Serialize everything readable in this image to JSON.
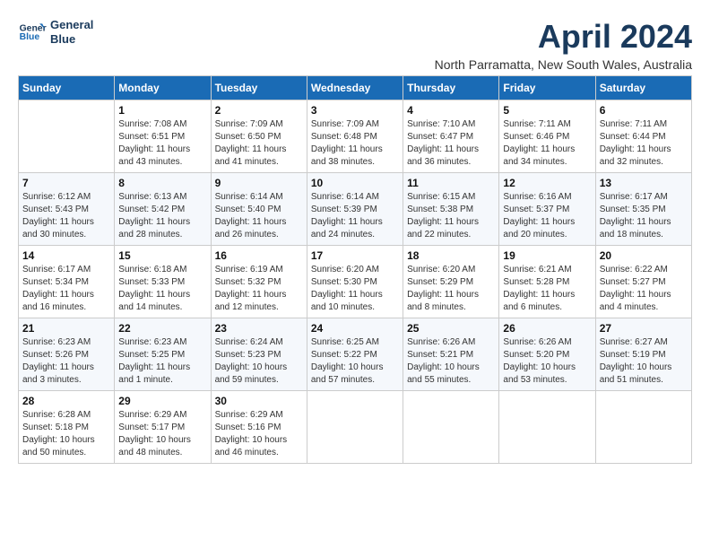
{
  "logo": {
    "line1": "General",
    "line2": "Blue"
  },
  "title": "April 2024",
  "subtitle": "North Parramatta, New South Wales, Australia",
  "headers": [
    "Sunday",
    "Monday",
    "Tuesday",
    "Wednesday",
    "Thursday",
    "Friday",
    "Saturday"
  ],
  "weeks": [
    [
      {
        "day": "",
        "info": ""
      },
      {
        "day": "1",
        "info": "Sunrise: 7:08 AM\nSunset: 6:51 PM\nDaylight: 11 hours\nand 43 minutes."
      },
      {
        "day": "2",
        "info": "Sunrise: 7:09 AM\nSunset: 6:50 PM\nDaylight: 11 hours\nand 41 minutes."
      },
      {
        "day": "3",
        "info": "Sunrise: 7:09 AM\nSunset: 6:48 PM\nDaylight: 11 hours\nand 38 minutes."
      },
      {
        "day": "4",
        "info": "Sunrise: 7:10 AM\nSunset: 6:47 PM\nDaylight: 11 hours\nand 36 minutes."
      },
      {
        "day": "5",
        "info": "Sunrise: 7:11 AM\nSunset: 6:46 PM\nDaylight: 11 hours\nand 34 minutes."
      },
      {
        "day": "6",
        "info": "Sunrise: 7:11 AM\nSunset: 6:44 PM\nDaylight: 11 hours\nand 32 minutes."
      }
    ],
    [
      {
        "day": "7",
        "info": "Sunrise: 6:12 AM\nSunset: 5:43 PM\nDaylight: 11 hours\nand 30 minutes."
      },
      {
        "day": "8",
        "info": "Sunrise: 6:13 AM\nSunset: 5:42 PM\nDaylight: 11 hours\nand 28 minutes."
      },
      {
        "day": "9",
        "info": "Sunrise: 6:14 AM\nSunset: 5:40 PM\nDaylight: 11 hours\nand 26 minutes."
      },
      {
        "day": "10",
        "info": "Sunrise: 6:14 AM\nSunset: 5:39 PM\nDaylight: 11 hours\nand 24 minutes."
      },
      {
        "day": "11",
        "info": "Sunrise: 6:15 AM\nSunset: 5:38 PM\nDaylight: 11 hours\nand 22 minutes."
      },
      {
        "day": "12",
        "info": "Sunrise: 6:16 AM\nSunset: 5:37 PM\nDaylight: 11 hours\nand 20 minutes."
      },
      {
        "day": "13",
        "info": "Sunrise: 6:17 AM\nSunset: 5:35 PM\nDaylight: 11 hours\nand 18 minutes."
      }
    ],
    [
      {
        "day": "14",
        "info": "Sunrise: 6:17 AM\nSunset: 5:34 PM\nDaylight: 11 hours\nand 16 minutes."
      },
      {
        "day": "15",
        "info": "Sunrise: 6:18 AM\nSunset: 5:33 PM\nDaylight: 11 hours\nand 14 minutes."
      },
      {
        "day": "16",
        "info": "Sunrise: 6:19 AM\nSunset: 5:32 PM\nDaylight: 11 hours\nand 12 minutes."
      },
      {
        "day": "17",
        "info": "Sunrise: 6:20 AM\nSunset: 5:30 PM\nDaylight: 11 hours\nand 10 minutes."
      },
      {
        "day": "18",
        "info": "Sunrise: 6:20 AM\nSunset: 5:29 PM\nDaylight: 11 hours\nand 8 minutes."
      },
      {
        "day": "19",
        "info": "Sunrise: 6:21 AM\nSunset: 5:28 PM\nDaylight: 11 hours\nand 6 minutes."
      },
      {
        "day": "20",
        "info": "Sunrise: 6:22 AM\nSunset: 5:27 PM\nDaylight: 11 hours\nand 4 minutes."
      }
    ],
    [
      {
        "day": "21",
        "info": "Sunrise: 6:23 AM\nSunset: 5:26 PM\nDaylight: 11 hours\nand 3 minutes."
      },
      {
        "day": "22",
        "info": "Sunrise: 6:23 AM\nSunset: 5:25 PM\nDaylight: 11 hours\nand 1 minute."
      },
      {
        "day": "23",
        "info": "Sunrise: 6:24 AM\nSunset: 5:23 PM\nDaylight: 10 hours\nand 59 minutes."
      },
      {
        "day": "24",
        "info": "Sunrise: 6:25 AM\nSunset: 5:22 PM\nDaylight: 10 hours\nand 57 minutes."
      },
      {
        "day": "25",
        "info": "Sunrise: 6:26 AM\nSunset: 5:21 PM\nDaylight: 10 hours\nand 55 minutes."
      },
      {
        "day": "26",
        "info": "Sunrise: 6:26 AM\nSunset: 5:20 PM\nDaylight: 10 hours\nand 53 minutes."
      },
      {
        "day": "27",
        "info": "Sunrise: 6:27 AM\nSunset: 5:19 PM\nDaylight: 10 hours\nand 51 minutes."
      }
    ],
    [
      {
        "day": "28",
        "info": "Sunrise: 6:28 AM\nSunset: 5:18 PM\nDaylight: 10 hours\nand 50 minutes."
      },
      {
        "day": "29",
        "info": "Sunrise: 6:29 AM\nSunset: 5:17 PM\nDaylight: 10 hours\nand 48 minutes."
      },
      {
        "day": "30",
        "info": "Sunrise: 6:29 AM\nSunset: 5:16 PM\nDaylight: 10 hours\nand 46 minutes."
      },
      {
        "day": "",
        "info": ""
      },
      {
        "day": "",
        "info": ""
      },
      {
        "day": "",
        "info": ""
      },
      {
        "day": "",
        "info": ""
      }
    ]
  ]
}
